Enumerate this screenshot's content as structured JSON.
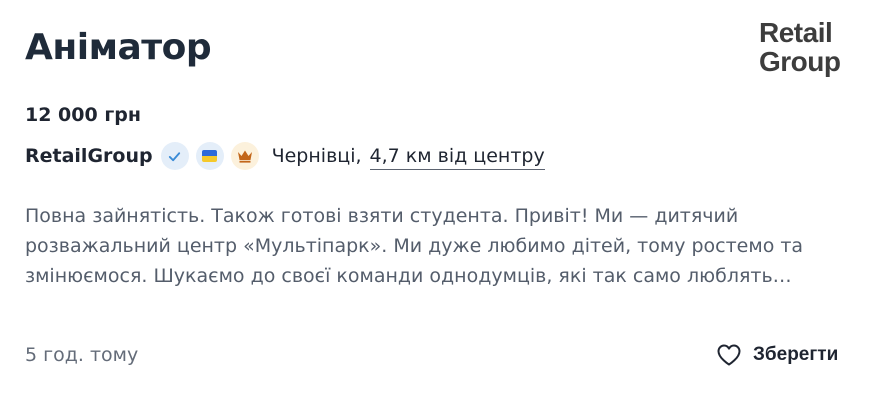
{
  "vacancy": {
    "title": "Аніматор",
    "salary": "12 000 грн",
    "company": "RetailGroup",
    "city": "Чернівці,",
    "distance": "4,7 км від центру",
    "description": "Повна зайнятість. Також готові взяти студента. Привіт! Ми — дитячий розважальний центр «Мультіпарк». Ми дуже любимо дітей, тому ростемо та змінюємося. Шукаємо до своєї команди однодумців, які так само люблять…",
    "posted": "5 год. тому",
    "save_label": "Зберегти"
  },
  "logo": {
    "line1": "Retail",
    "line2": "Group"
  },
  "icons": {
    "verified": "check-icon",
    "ua": "ukraine-flag-icon",
    "crown": "crown-icon",
    "save": "heart-icon"
  },
  "colors": {
    "title": "#1f2b3a",
    "text": "#1f2531",
    "muted": "#545d6b",
    "badge_blue_bg": "#e4eef9",
    "badge_crown_bg": "#fcf1dc",
    "crown": "#c2661a",
    "check": "#3a8bd6"
  }
}
